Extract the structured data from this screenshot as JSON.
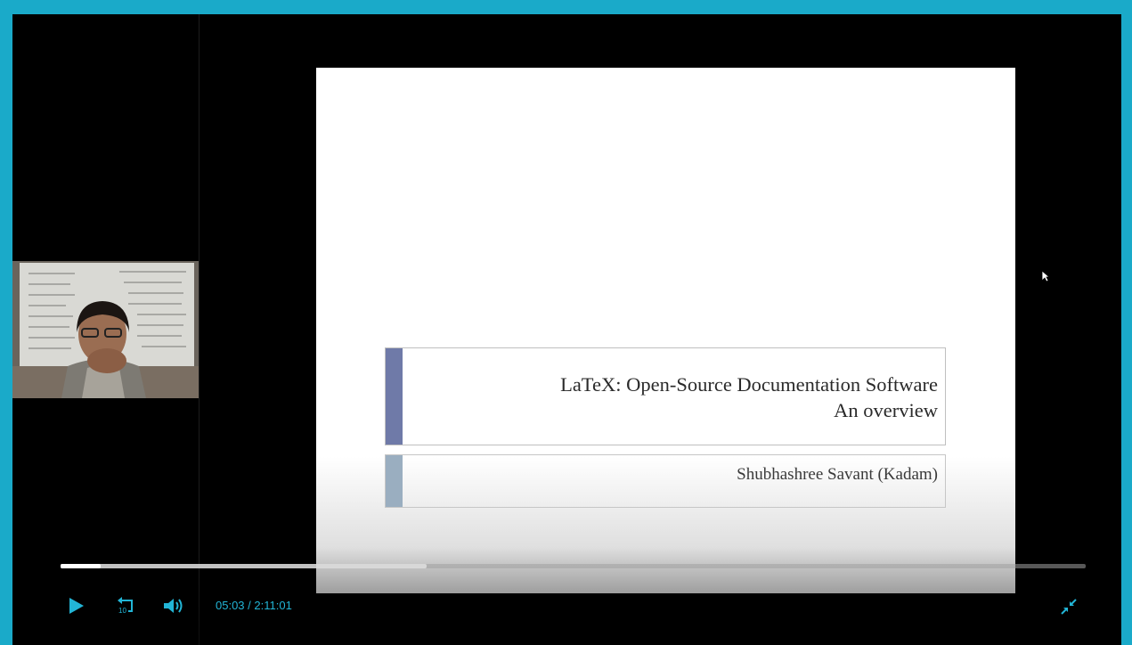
{
  "slide": {
    "title_line1": "LaTeX: Open-Source Documentation Software",
    "title_line2": "An overview",
    "author": "Shubhashree Savant (Kadam)"
  },
  "player": {
    "current_time": "05:03",
    "separator": "/",
    "duration": "2:11:01",
    "progress_fraction": 0.039,
    "buffered_fraction": 0.357,
    "icons": [
      "play-icon",
      "rewind-10-icon",
      "volume-icon",
      "exit-fullscreen-icon"
    ],
    "accent_color": "#22b5d6",
    "frame_color": "#1aaac9"
  }
}
